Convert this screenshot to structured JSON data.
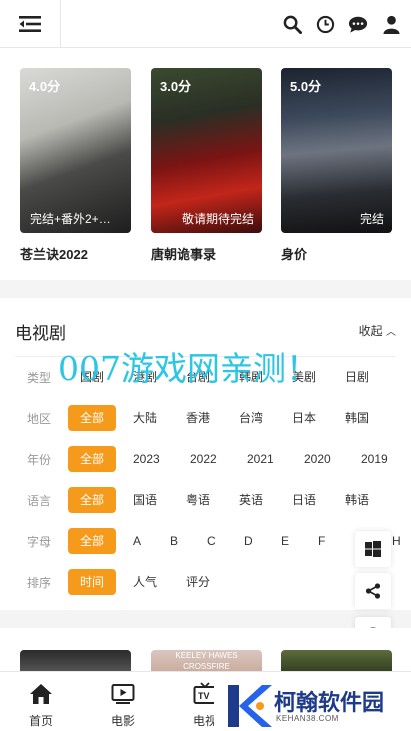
{
  "posters": [
    {
      "score": "4.0分",
      "note": "完结+番外2+…",
      "title": "苍兰诀2022"
    },
    {
      "score": "3.0分",
      "note": "敬请期待完结",
      "title": "唐朝诡事录"
    },
    {
      "score": "5.0分",
      "note": "完结",
      "title": "身价"
    }
  ],
  "filter": {
    "title": "电视剧",
    "collapse_label": "收起",
    "rows": [
      {
        "label": "类型",
        "options": [
          "国剧",
          "港剧",
          "台剧",
          "韩剧",
          "美剧",
          "日剧"
        ]
      },
      {
        "label": "地区",
        "options": [
          "全部",
          "大陆",
          "香港",
          "台湾",
          "日本",
          "韩国"
        ]
      },
      {
        "label": "年份",
        "options": [
          "全部",
          "2023",
          "2022",
          "2021",
          "2020",
          "2019"
        ]
      },
      {
        "label": "语言",
        "options": [
          "全部",
          "国语",
          "粤语",
          "英语",
          "日语",
          "韩语"
        ]
      },
      {
        "label": "字母",
        "options": [
          "全部",
          "A",
          "B",
          "C",
          "D",
          "E",
          "F",
          "G",
          "H"
        ]
      },
      {
        "label": "排序",
        "options": [
          "时间",
          "人气",
          "评分"
        ]
      }
    ]
  },
  "watermark": "007游戏网亲测！",
  "bottom_poster_text": "KEELEY HAWES CROSSFIRE",
  "tabs": [
    {
      "label": "首页",
      "icon": "home-icon"
    },
    {
      "label": "电影",
      "icon": "movie-icon"
    },
    {
      "label": "电视",
      "icon": "tv-icon"
    }
  ],
  "logo": {
    "name": "柯翰软件园",
    "domain": "KEHAN38.COM"
  },
  "colors": {
    "accent": "#f59a1b",
    "watermark": "#2bc6e4"
  }
}
